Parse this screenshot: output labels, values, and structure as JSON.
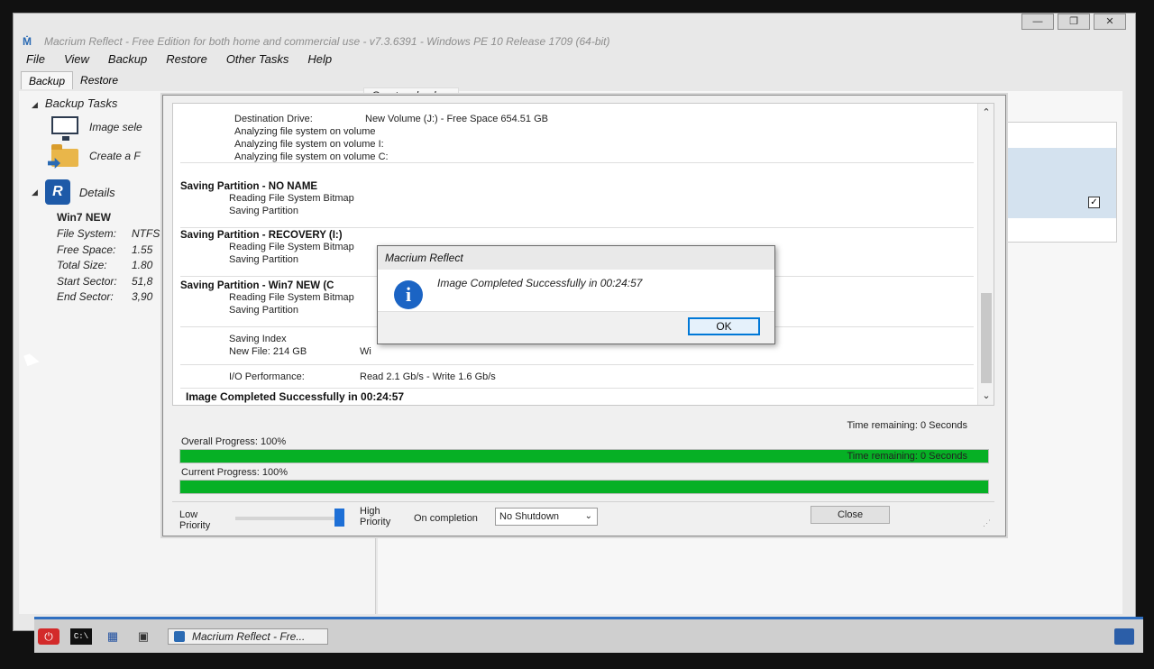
{
  "app": {
    "title": "Macrium Reflect - Free Edition for both home and commercial use - v7.3.6391 - Windows PE 10 Release 1709 (64-bit)"
  },
  "menu": [
    "File",
    "View",
    "Backup",
    "Restore",
    "Other Tasks",
    "Help"
  ],
  "tabs": [
    "Backup",
    "Restore"
  ],
  "create_tab": "Create a backup",
  "left": {
    "backup_tasks": "Backup Tasks",
    "task_image": "Image sele",
    "task_create": "Create a F",
    "details_label": "Details",
    "disk_name": "Win7 NEW",
    "details": [
      {
        "label": "File System:",
        "value": "NTFS"
      },
      {
        "label": "Free Space:",
        "value": "1.55"
      },
      {
        "label": "Total Size:",
        "value": "1.80"
      },
      {
        "label": "Start Sector:",
        "value": "51,8"
      },
      {
        "label": "End Sector:",
        "value": "3,90"
      }
    ]
  },
  "log": {
    "dest_label": "Destination Drive:",
    "dest_value": "New Volume (J:) - Free Space 654.51 GB",
    "analyzing": [
      "Analyzing file system on volume",
      "Analyzing file system on volume I:",
      "Analyzing file system on volume C:"
    ],
    "sections": [
      {
        "title": "Saving Partition - NO NAME",
        "lines": [
          "Reading File System Bitmap",
          "Saving Partition"
        ]
      },
      {
        "title": "Saving Partition - RECOVERY (I:)",
        "lines": [
          "Reading File System Bitmap",
          "Saving Partition"
        ]
      },
      {
        "title": "Saving Partition - Win7 NEW (C",
        "lines": [
          "Reading File System Bitmap",
          "Saving Partition"
        ]
      }
    ],
    "saving_index": "Saving Index",
    "new_file_label": "New File: 214 GB",
    "new_file_value": "Wi",
    "io_label": "I/O Performance:",
    "io_value": "Read 2.1 Gb/s - Write 1.6 Gb/s",
    "final": "Image Completed Successfully in 00:24:57"
  },
  "progress": {
    "overall_label": "Overall Progress:  100%",
    "overall_time": "Time remaining: 0 Seconds",
    "overall_value": 1.0,
    "current_label": "Current Progress:  100%",
    "current_time": "Time remaining: 0 Seconds",
    "current_value": 1.0,
    "bar_color": "#06b025"
  },
  "controls": {
    "low_priority": "Low Priority",
    "high_priority": "High Priority",
    "priority_level": 1.0,
    "on_completion": "On completion",
    "shutdown_value": "No Shutdown",
    "close": "Close"
  },
  "msgbox": {
    "title": "Macrium Reflect",
    "text": "Image Completed Successfully in 00:24:57",
    "ok": "OK"
  },
  "taskbar": {
    "app_label": "Macrium Reflect - Fre..."
  }
}
